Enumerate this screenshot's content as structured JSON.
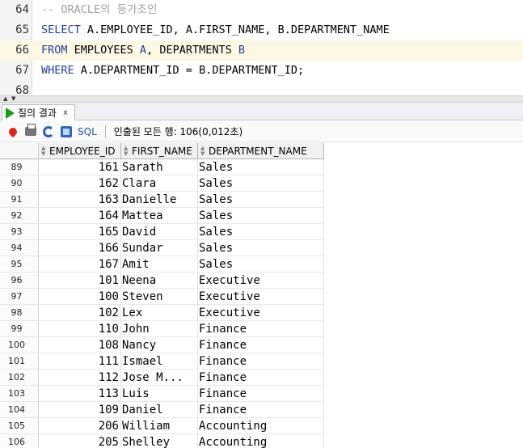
{
  "editor": {
    "lines": [
      {
        "number": "64",
        "parts": [
          {
            "t": "-- ORACLE의 등가조인",
            "c": "cm"
          }
        ]
      },
      {
        "number": "65",
        "parts": [
          {
            "t": "SELECT",
            "c": "kw"
          },
          {
            "t": " A.EMPLOYEE_ID, A.FIRST_NAME, B.DEPARTMENT_NAME",
            "c": ""
          }
        ]
      },
      {
        "number": "66",
        "parts": [
          {
            "t": "FROM",
            "c": "kw"
          },
          {
            "t": " EMPLOYEES ",
            "c": ""
          },
          {
            "t": "A",
            "c": "kw"
          },
          {
            "t": ", DEPARTMENTS ",
            "c": ""
          },
          {
            "t": "B",
            "c": "kw"
          }
        ],
        "current": true
      },
      {
        "number": "67",
        "parts": [
          {
            "t": "WHERE",
            "c": "kw"
          },
          {
            "t": " A.DEPARTMENT_ID = B.DEPARTMENT_ID;",
            "c": ""
          }
        ]
      },
      {
        "number": "68",
        "parts": []
      }
    ]
  },
  "result_tab": {
    "label": "질의 결과",
    "close": "x"
  },
  "toolbar": {
    "sql_label": "SQL",
    "status": "인출된 모든 행: 106(0,012초)"
  },
  "grid": {
    "columns": [
      "EMPLOYEE_ID",
      "FIRST_NAME",
      "DEPARTMENT_NAME"
    ],
    "rows": [
      {
        "rownum": "89",
        "employee_id": "161",
        "first_name": "Sarath",
        "department_name": "Sales"
      },
      {
        "rownum": "90",
        "employee_id": "162",
        "first_name": "Clara",
        "department_name": "Sales"
      },
      {
        "rownum": "91",
        "employee_id": "163",
        "first_name": "Danielle",
        "department_name": "Sales"
      },
      {
        "rownum": "92",
        "employee_id": "164",
        "first_name": "Mattea",
        "department_name": "Sales"
      },
      {
        "rownum": "93",
        "employee_id": "165",
        "first_name": "David",
        "department_name": "Sales"
      },
      {
        "rownum": "94",
        "employee_id": "166",
        "first_name": "Sundar",
        "department_name": "Sales"
      },
      {
        "rownum": "95",
        "employee_id": "167",
        "first_name": "Amit",
        "department_name": "Sales"
      },
      {
        "rownum": "96",
        "employee_id": "101",
        "first_name": "Neena",
        "department_name": "Executive"
      },
      {
        "rownum": "97",
        "employee_id": "100",
        "first_name": "Steven",
        "department_name": "Executive"
      },
      {
        "rownum": "98",
        "employee_id": "102",
        "first_name": "Lex",
        "department_name": "Executive"
      },
      {
        "rownum": "99",
        "employee_id": "110",
        "first_name": "John",
        "department_name": "Finance"
      },
      {
        "rownum": "100",
        "employee_id": "108",
        "first_name": "Nancy",
        "department_name": "Finance"
      },
      {
        "rownum": "101",
        "employee_id": "111",
        "first_name": "Ismael",
        "department_name": "Finance"
      },
      {
        "rownum": "102",
        "employee_id": "112",
        "first_name": "Jose M...",
        "department_name": "Finance"
      },
      {
        "rownum": "103",
        "employee_id": "113",
        "first_name": "Luis",
        "department_name": "Finance"
      },
      {
        "rownum": "104",
        "employee_id": "109",
        "first_name": "Daniel",
        "department_name": "Finance"
      },
      {
        "rownum": "105",
        "employee_id": "206",
        "first_name": "William",
        "department_name": "Accounting"
      },
      {
        "rownum": "106",
        "employee_id": "205",
        "first_name": "Shelley",
        "department_name": "Accounting"
      }
    ]
  },
  "colors": {
    "keyword": "#1f3f9d",
    "comment": "#a0a0a0",
    "current_line": "#fdf8e5",
    "run_icon": "#1a9e1a"
  }
}
